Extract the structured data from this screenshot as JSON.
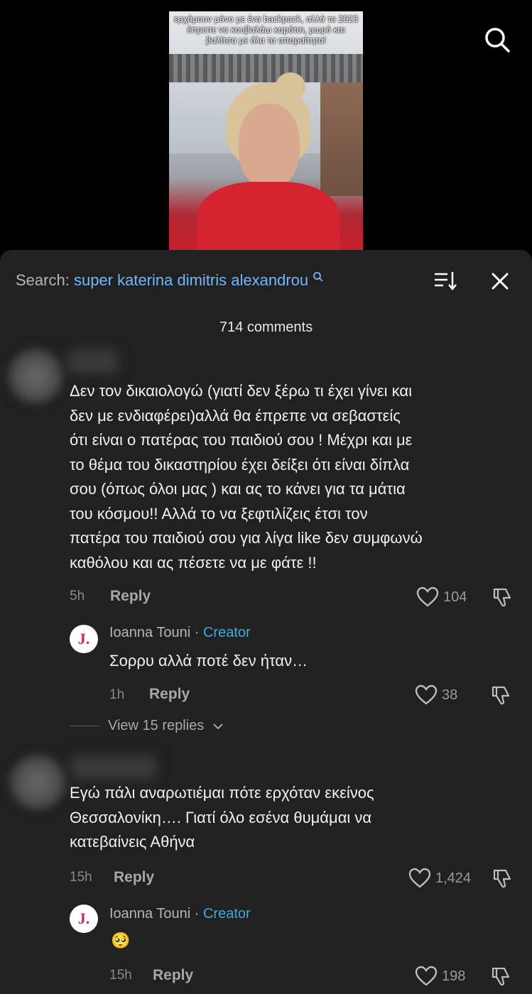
{
  "video": {
    "caption": "ερχόμουν μόνο με ένα backpack, αλλά το 2023 έπρεπε να κουβαλάω καρότσι, μωρό και βαλίτσα με όλα τα απαραίτητα!"
  },
  "header": {
    "search_label": "Search:",
    "search_query": "super katerina dimitris alexandrou",
    "comment_count": "714 comments"
  },
  "comments": [
    {
      "text_lines": [
        "Δεν τον δικαιολογώ (γιατί δεν ξέρω τι έχει γίνει και",
        "δεν με ενδιαφέρει)αλλά θα έπρεπε να σεβαστείς",
        "ότι είναι ο πατέρας του παιδιού σου ! Μέχρι και με",
        "το θέμα του δικαστηρίου έχει δείξει ότι είναι δίπλα",
        "σου (όπως όλοι μας ) και ας το κάνει για τα μάτια",
        "του κόσμου!! Αλλά το να ξεφτιλίζεις έτσι τον",
        "πατέρα του παιδιού σου για λίγα like δεν συμφωνώ",
        "καθόλου και ας πέσετε να με φάτε !!"
      ],
      "time": "5h",
      "reply_label": "Reply",
      "likes": "104",
      "creator_reply": {
        "avatar_letter": "J.",
        "name": "Ioanna Touni",
        "separator": "·",
        "badge": "Creator",
        "text": "Σορρυ αλλά ποτέ δεν ήταν…",
        "time": "1h",
        "reply_label": "Reply",
        "likes": "38"
      },
      "view_replies": "View 15 replies"
    },
    {
      "text_lines": [
        "Εγώ πάλι αναρωτιέμαι πότε ερχόταν εκείνος",
        "Θεσσαλονίκη…. Γιατί όλο εσένα θυμάμαι να",
        "κατεβαίνεις Αθήνα"
      ],
      "time": "15h",
      "reply_label": "Reply",
      "likes": "1,424",
      "creator_reply": {
        "avatar_letter": "J.",
        "name": "Ioanna Touni",
        "separator": "·",
        "badge": "Creator",
        "text": "🥺",
        "time": "15h",
        "reply_label": "Reply",
        "likes": "198"
      }
    }
  ]
}
